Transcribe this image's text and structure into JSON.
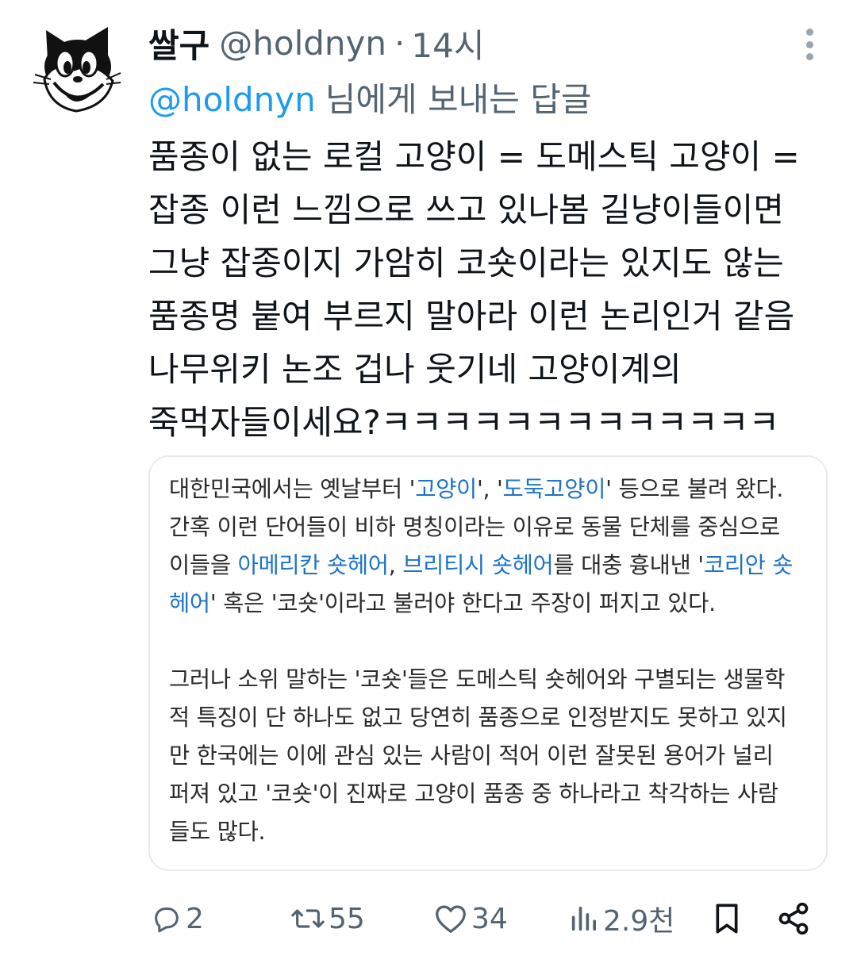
{
  "tweet": {
    "author_name": "쌀구",
    "author_handle": "@holdnyn",
    "separator": "·",
    "time": "14시",
    "reply_to_handle": "@holdnyn",
    "reply_to_suffix": "님에게 보내는 답글",
    "body_lines": [
      "품종이 없는 로컬 고양이 = 도메스틱 고양이  =",
      "잡종 이런 느낌으로 쓰고 있나봄 길냥이들이면",
      "그냥 잡종이지 가암히 코숏이라는 있지도 않는",
      "품종명 붙여 부르지 말아라 이런 논리인거 같음",
      "나무위키 논조 겁나 웃기네 고양이계의",
      "죽먹자들이세요?ㅋㅋㅋㅋㅋㅋㅋㅋㅋㅋㅋㅋㅋ"
    ]
  },
  "quote": {
    "p1": {
      "l1": [
        "대한민국에서는 옛날부터 '",
        "고양이",
        "', '",
        "도둑고양이",
        "' 등으로 불려 왔다."
      ],
      "l2": "간혹 이런 단어들이 비하 명칭이라는 이유로 동물 단체를 중심으로",
      "l3": [
        "이들을 ",
        "아메리칸 숏헤어",
        ", ",
        "브리티시 숏헤어",
        "를 대충 흉내낸 '",
        "코리안 숏"
      ],
      "l4": [
        "헤어",
        "' 혹은 '코숏'이라고 불러야 한다고 주장이 퍼지고 있다."
      ]
    },
    "p2": [
      "그러나 소위 말하는 '코숏'들은 도메스틱 숏헤어와 구별되는 생물학",
      "적 특징이 단 하나도 없고 당연히 품종으로 인정받지도 못하고 있지",
      "만 한국에는 이에 관심 있는 사람이 적어 이런 잘못된 용어가 널리",
      "퍼져 있고 '코숏'이 진짜로 고양이 품종 중 하나라고 착각하는 사람",
      "들도 많다."
    ],
    "link_color": "#1f73c8"
  },
  "actions": {
    "replies": "2",
    "retweets": "55",
    "likes": "34",
    "views": "2.9천"
  },
  "icons": {
    "avatar": "felix-the-cat-avatar",
    "more": "more-options-icon",
    "reply": "reply-icon",
    "retweet": "retweet-icon",
    "like": "heart-icon",
    "views": "views-icon",
    "bookmark": "bookmark-icon",
    "share": "share-icon"
  },
  "colors": {
    "text": "#0f1419",
    "secondary": "#536471",
    "mention": "#1d9bf0"
  }
}
